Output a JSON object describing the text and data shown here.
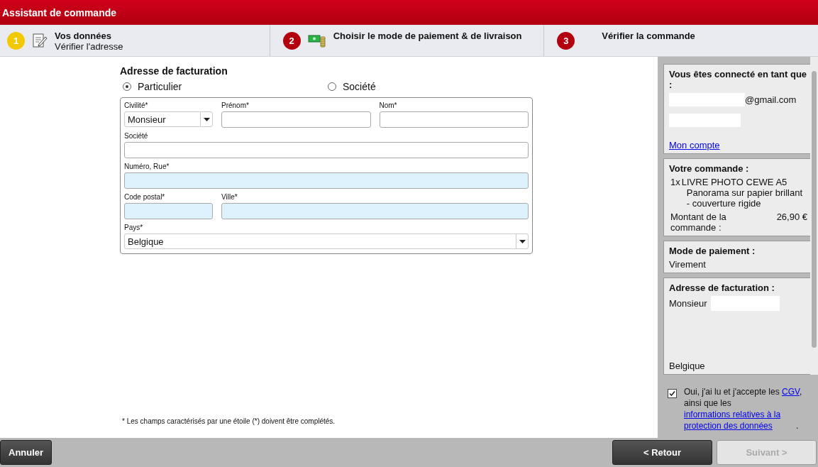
{
  "window": {
    "title": "Assistant de commande"
  },
  "steps": [
    {
      "number": "1",
      "title": "Vos données",
      "subtitle": "Vérifier l'adresse",
      "selected": true
    },
    {
      "number": "2",
      "title": "Choisir le mode de paiement & de livraison",
      "selected": false
    },
    {
      "number": "3",
      "title": "Vérifier la commande",
      "selected": false
    }
  ],
  "billing": {
    "heading": "Adresse de facturation",
    "customer_types": [
      {
        "label": "Particulier",
        "selected": true
      },
      {
        "label": "Société",
        "selected": false
      }
    ],
    "rows": [
      [
        {
          "label": "Civilité*",
          "kind": "select",
          "value": "Monsieur",
          "highlighted": false
        },
        {
          "label": "Prénom*",
          "kind": "text",
          "highlighted": false
        },
        {
          "label": "Nom*",
          "kind": "text",
          "highlighted": false
        }
      ],
      [
        {
          "label": "Société",
          "kind": "text",
          "highlighted": false
        }
      ],
      [
        {
          "label": "Numéro, Rue*",
          "kind": "text",
          "highlighted": true
        }
      ],
      [
        {
          "label": "Code postal*",
          "kind": "text",
          "highlighted": true
        },
        {
          "label": "Ville*",
          "kind": "text",
          "highlighted": true
        }
      ],
      [
        {
          "label": "Pays*",
          "kind": "select",
          "value": "Belgique",
          "highlighted": false
        }
      ]
    ],
    "footnote": "* Les champs caractérisés par une étoile (*) doivent être complétés."
  },
  "summary": {
    "account": {
      "heading": "Vous êtes connecté en tant que :",
      "email_suffix": "@gmail.com",
      "link": "Mon compte"
    },
    "order": {
      "heading": "Votre commande :",
      "items": [
        {
          "quantity": "1x",
          "name": "LIVRE PHOTO CEWE A5",
          "description": "Panorama sur papier brillant - couverture rigide"
        }
      ],
      "total_label": "Montant de la commande :",
      "total": "26,90 €"
    },
    "payment": {
      "heading": "Mode de paiement :",
      "value": "Virement"
    },
    "address": {
      "heading": "Adresse de facturation :",
      "salutation": "Monsieur",
      "country": "Belgique"
    }
  },
  "terms": {
    "checked": true,
    "text_before": "Oui, j'ai lu et j'accepte les",
    "link1": "CGV",
    "text_middle": ", ainsi que les",
    "link2": "informations relatives à la protection des données",
    "text_after": "."
  },
  "buttons": {
    "cancel": {
      "label": "Annuler",
      "disabled": false
    },
    "back": {
      "label": "< Retour",
      "disabled": false
    },
    "next": {
      "label": "Suivant >",
      "disabled": true
    }
  }
}
